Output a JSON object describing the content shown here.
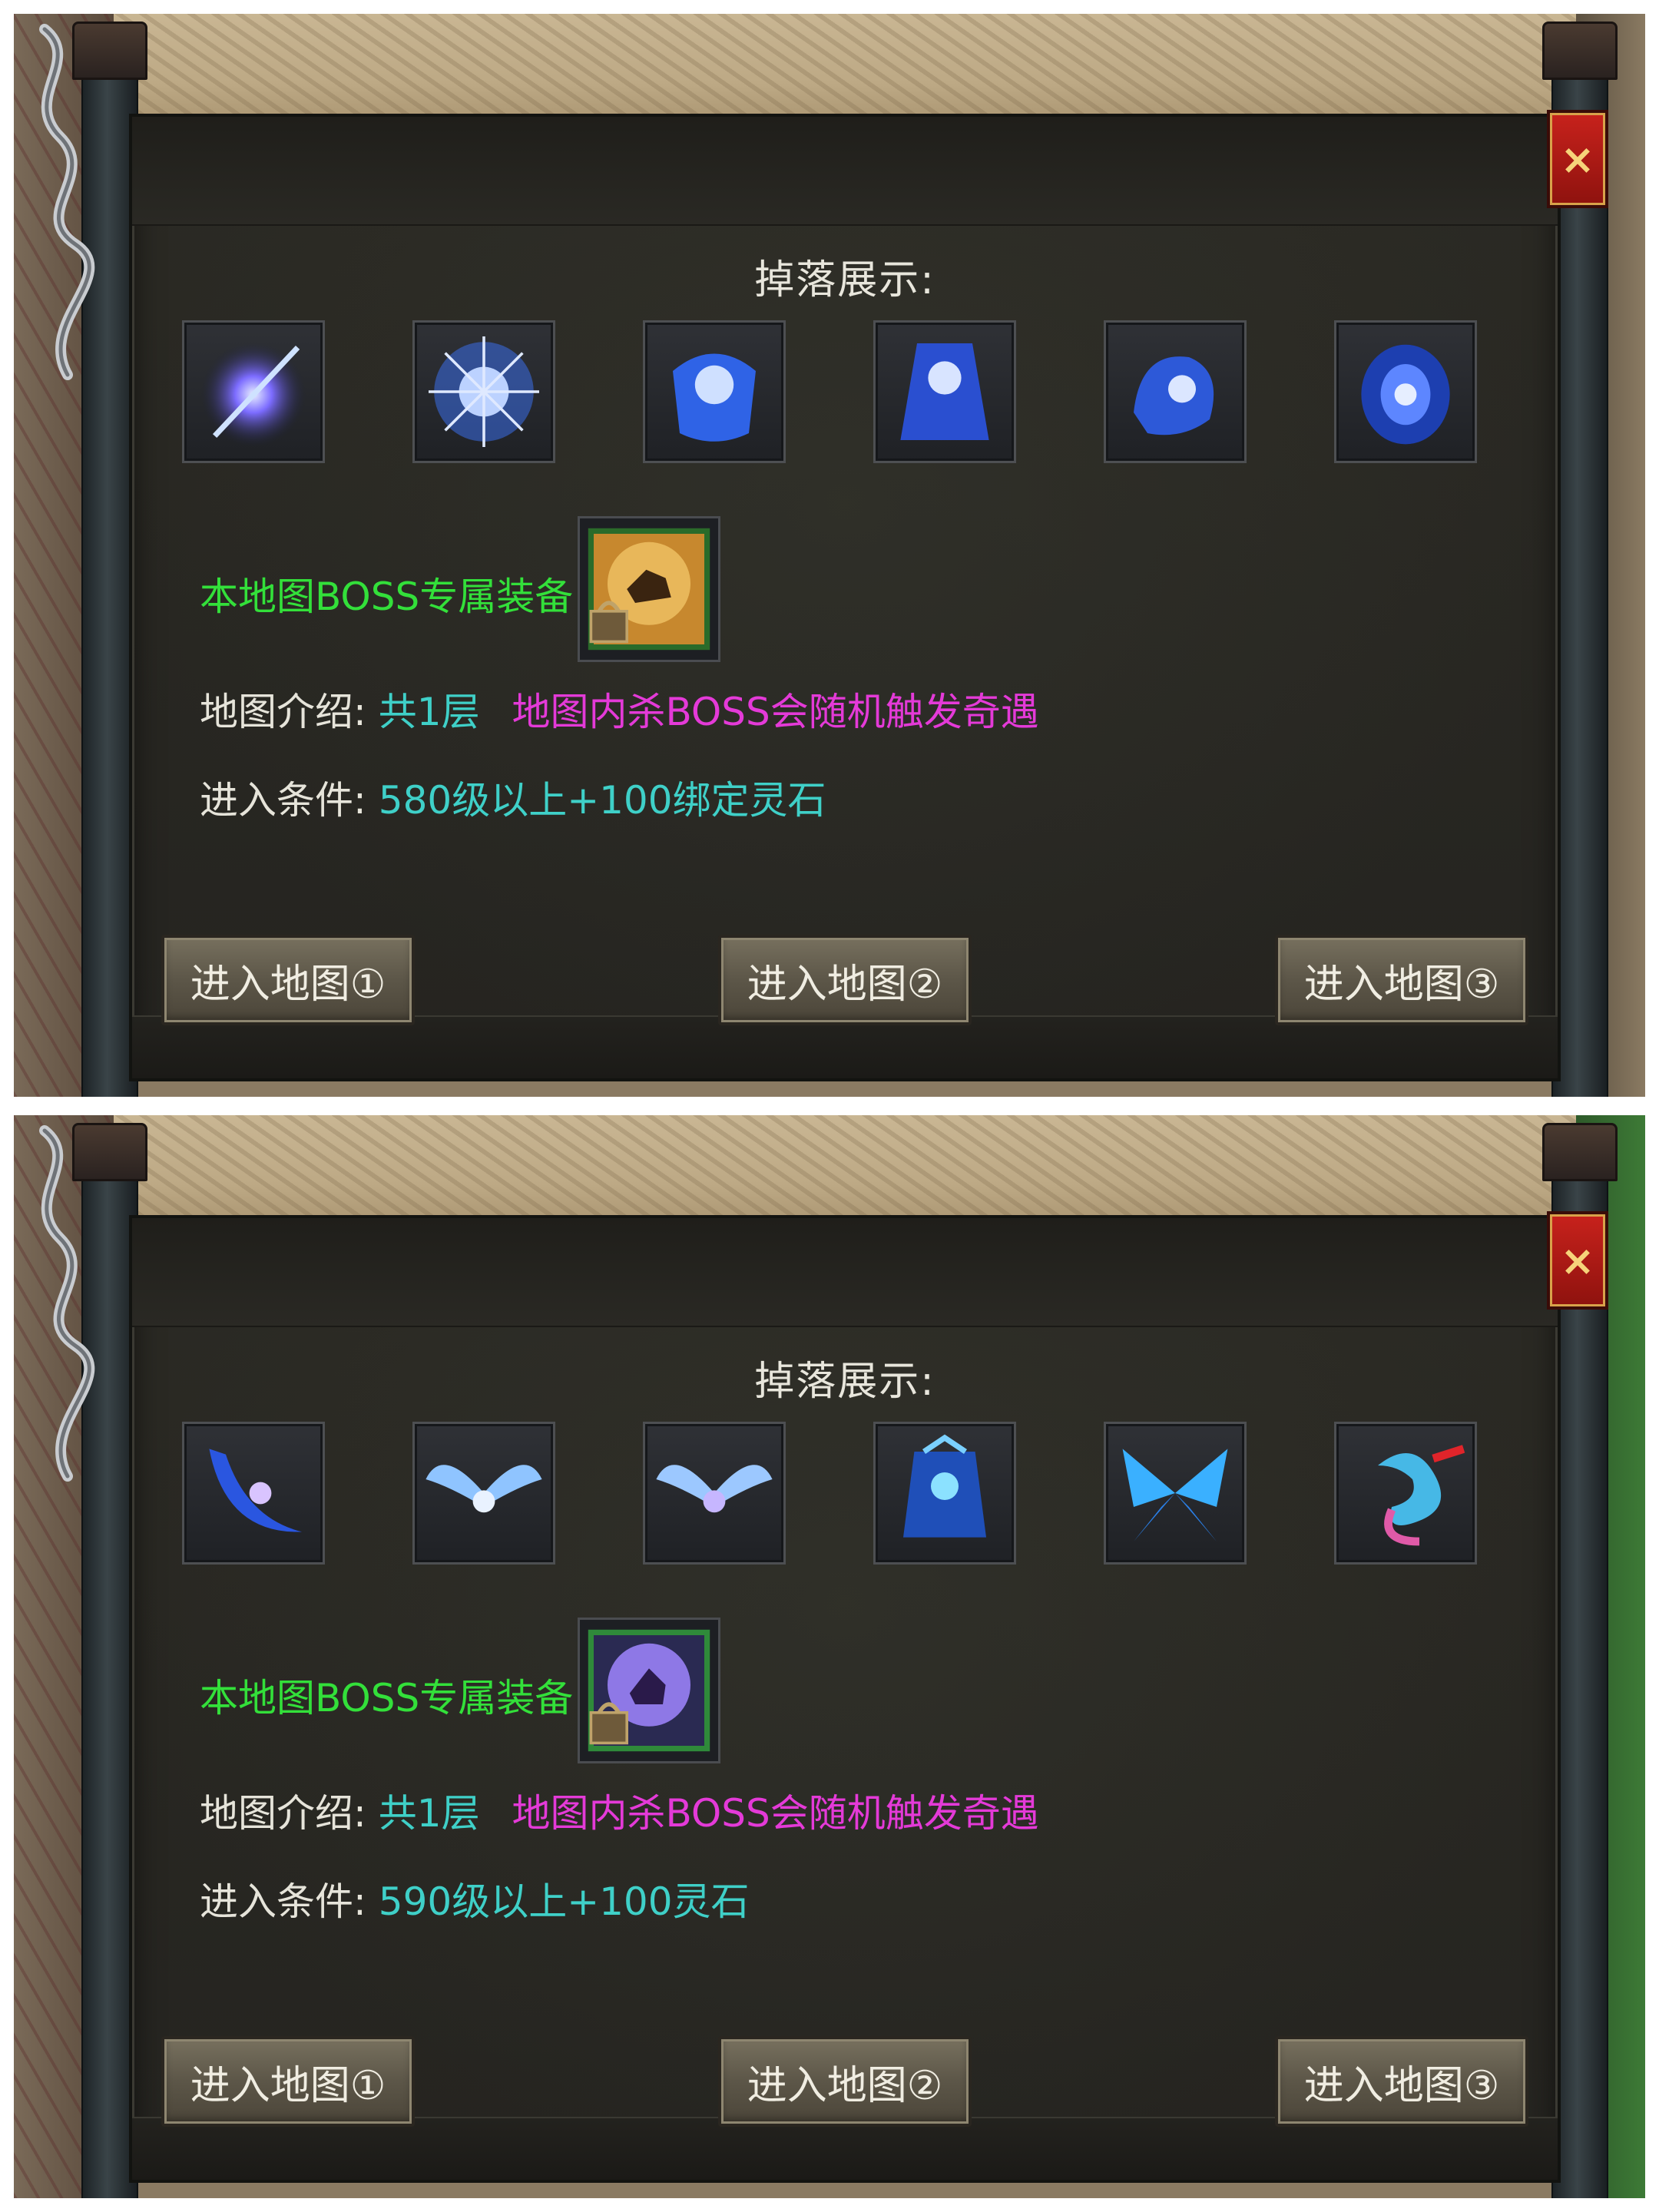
{
  "panels": [
    {
      "title": "掉落展示:",
      "drop_icons": [
        "blue-spear-icon",
        "blue-burst-icon",
        "blue-armor-icon",
        "blue-robe-icon",
        "blue-helmet-icon",
        "blue-ring-icon"
      ],
      "boss_label": "本地图BOSS专属装备:",
      "boss_item_icon": "locked-dog-medal-icon",
      "intro_key": "地图介绍:",
      "intro_layers": "共1层",
      "intro_desc": "地图内杀BOSS会随机触发奇遇",
      "req_key": "进入条件:",
      "req_value": "580级以上+100绑定灵石",
      "buttons": [
        "进入地图①",
        "进入地图②",
        "进入地图③"
      ],
      "close_label": "×"
    },
    {
      "title": "掉落展示:",
      "drop_icons": [
        "blue-scythe-icon",
        "blue-wings-icon",
        "blue-wings-icon-2",
        "blue-armor-icon",
        "blue-butterfly-wings-icon",
        "blue-dragon-icon"
      ],
      "boss_label": "本地图BOSS专属装备:",
      "boss_item_icon": "locked-purple-medal-icon",
      "intro_key": "地图介绍:",
      "intro_layers": "共1层",
      "intro_desc": "地图内杀BOSS会随机触发奇遇",
      "req_key": "进入条件:",
      "req_value": "590级以上+100灵石",
      "buttons": [
        "进入地图①",
        "进入地图②",
        "进入地图③"
      ],
      "close_label": "×"
    }
  ],
  "colors": {
    "green_label": "#33e03a",
    "cyan_value": "#3fd0c8",
    "magenta_desc": "#e43ad8",
    "close_red": "#c8221c"
  }
}
